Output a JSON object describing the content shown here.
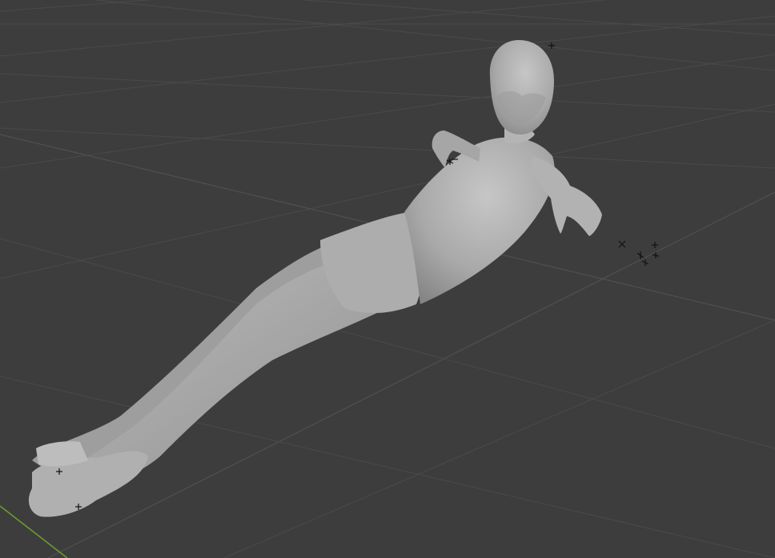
{
  "viewport": {
    "label": "3D Viewport",
    "background": "#3d3d3d",
    "grid_color": "#4a4a4a",
    "axis_y_color": "#6b9b2f",
    "mesh_color": "#a8a8a8",
    "mesh_shadow": "#7e7e7e",
    "mesh_highlight": "#c4c4c4"
  },
  "scene": {
    "object": "humanoid-sculpt-mesh",
    "marker_icon": "cross-marker-icon"
  }
}
